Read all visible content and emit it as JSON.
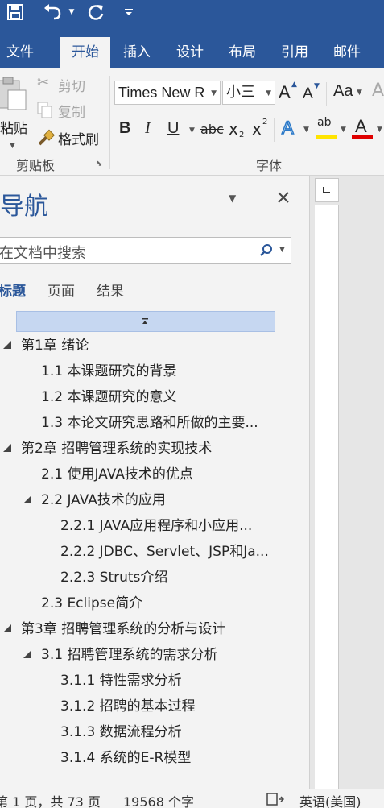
{
  "colors": {
    "accent": "#2b579a",
    "highlight": "#ffe400",
    "font_color": "#e00000"
  },
  "qat": {
    "save_icon": "save-icon",
    "undo_icon": "undo-icon",
    "redo_icon": "redo-icon",
    "customize_icon": "customize-qat-icon"
  },
  "tabs": [
    {
      "label": "文件"
    },
    {
      "label": "开始"
    },
    {
      "label": "插入"
    },
    {
      "label": "设计"
    },
    {
      "label": "布局"
    },
    {
      "label": "引用"
    },
    {
      "label": "邮件"
    }
  ],
  "ribbon": {
    "clipboard": {
      "paste": "粘贴",
      "cut": "剪切",
      "copy": "复制",
      "format_painter": "格式刷",
      "group_label": "剪贴板"
    },
    "font": {
      "font_name": "Times New R",
      "font_size": "小三",
      "grow": "A",
      "shrink": "A",
      "change_case": "Aa",
      "bold": "B",
      "italic": "I",
      "underline": "U",
      "strike": "abc",
      "subscript": "x",
      "subscript_digit": "2",
      "superscript": "x",
      "superscript_digit": "2",
      "text_effects": "A",
      "highlight": "ab",
      "font_color": "A",
      "group_label": "字体"
    }
  },
  "nav": {
    "title": "导航",
    "search_placeholder": "在文档中搜索",
    "subtabs": [
      "标题",
      "页面",
      "结果"
    ],
    "tree": [
      {
        "text": "第1章 绪论"
      },
      {
        "text": "1.1 本课题研究的背景"
      },
      {
        "text": "1.2 本课题研究的意义"
      },
      {
        "text": "1.3 本论文研究思路和所做的主要..."
      },
      {
        "text": "第2章 招聘管理系统的实现技术"
      },
      {
        "text": "2.1 使用JAVA技术的优点"
      },
      {
        "text": "2.2 JAVA技术的应用"
      },
      {
        "text": "2.2.1 JAVA应用程序和小应用..."
      },
      {
        "text": "2.2.2 JDBC、Servlet、JSP和Ja..."
      },
      {
        "text": "2.2.3 Struts介绍"
      },
      {
        "text": "2.3 Eclipse简介"
      },
      {
        "text": "第3章  招聘管理系统的分析与设计"
      },
      {
        "text": "3.1 招聘管理系统的需求分析"
      },
      {
        "text": "3.1.1 特性需求分析"
      },
      {
        "text": "3.1.2 招聘的基本过程"
      },
      {
        "text": "3.1.3 数据流程分析"
      },
      {
        "text": "3.1.4 系统的E-R模型"
      }
    ]
  },
  "status": {
    "page": "第 1 页，共 73 页",
    "words": "19568 个字",
    "language": "英语(美国)"
  }
}
